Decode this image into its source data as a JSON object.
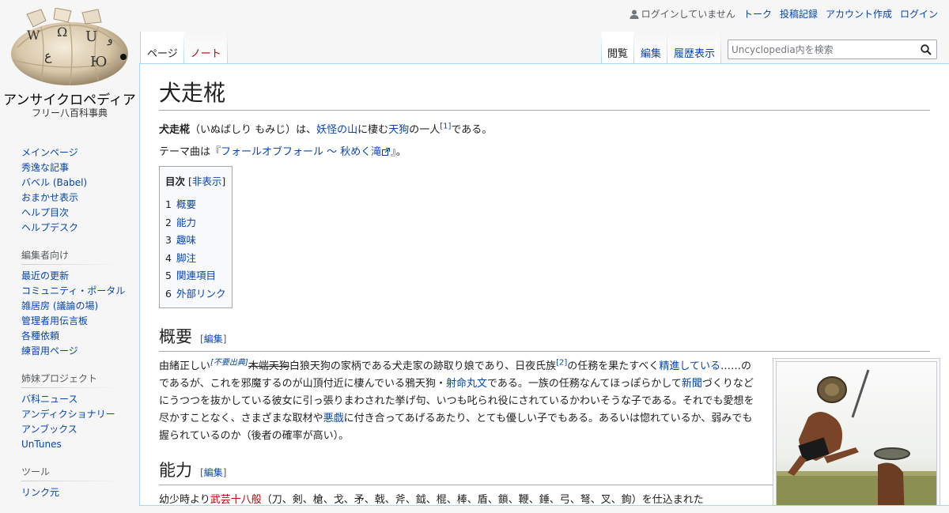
{
  "logo": {
    "name": "アンサイクロペディア",
    "tagline": "フリー八百科事典"
  },
  "personal": {
    "anon": "ログインしていません",
    "links": [
      "トーク",
      "投稿記録",
      "アカウント作成",
      "ログイン"
    ]
  },
  "tabs": {
    "left": [
      {
        "label": "ページ",
        "selected": true
      },
      {
        "label": "ノート",
        "red": true
      }
    ],
    "right": [
      {
        "label": "閲覧",
        "selected": true
      },
      {
        "label": "編集"
      },
      {
        "label": "履歴表示"
      }
    ]
  },
  "search": {
    "placeholder": "Uncyclopedia内を検索"
  },
  "sidebar": {
    "nav": [
      "メインページ",
      "秀逸な記事",
      "バベル (Babel)",
      "おまかせ表示",
      "ヘルプ目次",
      "ヘルプデスク"
    ],
    "editors": {
      "heading": "編集者向け",
      "items": [
        "最近の更新",
        "コミュニティ・ポータル",
        "雑居房 (議論の場)",
        "管理者用伝言板",
        "各種依頼",
        "練習用ページ"
      ]
    },
    "sisters": {
      "heading": "姉妹プロジェクト",
      "items": [
        "バ科ニュース",
        "アンディクショナリー",
        "アンブックス",
        "UnTunes"
      ]
    },
    "tools": {
      "heading": "ツール",
      "items": [
        "リンク元"
      ]
    }
  },
  "article": {
    "title": "犬走椛",
    "lead": {
      "bold": "犬走椛",
      "reading": "（いぬばしり もみじ）は、",
      "link1": "妖怪の山",
      "t1": "に棲む",
      "link2": "天狗",
      "t2": "の一人",
      "ref": "[1]",
      "t3": "である。"
    },
    "theme": {
      "t1": "テーマ曲は『",
      "link": "フォールオブフォール 〜 秋めく滝",
      "t2": "』。"
    },
    "toc": {
      "title": "目次",
      "toggle_open": "[",
      "toggle": "非表示",
      "toggle_close": "]",
      "items": [
        {
          "num": "1",
          "label": "概要"
        },
        {
          "num": "2",
          "label": "能力"
        },
        {
          "num": "3",
          "label": "趣味"
        },
        {
          "num": "4",
          "label": "脚注"
        },
        {
          "num": "5",
          "label": "関連項目"
        },
        {
          "num": "6",
          "label": "外部リンク"
        }
      ]
    },
    "edit_open": "[",
    "edit_label": "編集",
    "edit_close": "]",
    "s1": {
      "heading": "概要",
      "p1": "由緒正しい",
      "cn": "[不要出典]",
      "strike": "木端天狗",
      "p2": "白狼天狗の家柄である犬走家の跡取り娘であり、日夜氏族",
      "ref": "[2]",
      "p3": "の任務を果たすべく",
      "link1": "精進している",
      "p4": "……のであるが、これを邪魔するのが山頂付近に棲んでいる鴉天狗・",
      "link2": "射命丸文",
      "p5": "である。一族の任務なんてほっぽらかして",
      "link3": "新聞",
      "p6": "づくりなどにうつつを抜かしている彼女に引っ張りまわされた挙げ句、いつも叱られ役にされているかわいそうな子である。それでも愛想を尽かすことなく、さまざまな取材や",
      "link4": "悪戯",
      "p7": "に付き合ってあげるあたり、とても優しい子でもある。あるいは惚れているか、弱みでも握られているのか（後者の確率が高い）。"
    },
    "s2": {
      "heading": "能力",
      "p1": "幼少時より",
      "link1": "武芸十八般",
      "p2": "（刀、剣、槍、戈、矛、戟、斧、鉞、棍、棒、盾、鎖、鞭、錘、弓、弩、叉、鉤）を仕込まれた"
    }
  },
  "colors": {
    "link": "#0645ad",
    "redlink": "#ba0000",
    "border": "#a7d7f9"
  }
}
